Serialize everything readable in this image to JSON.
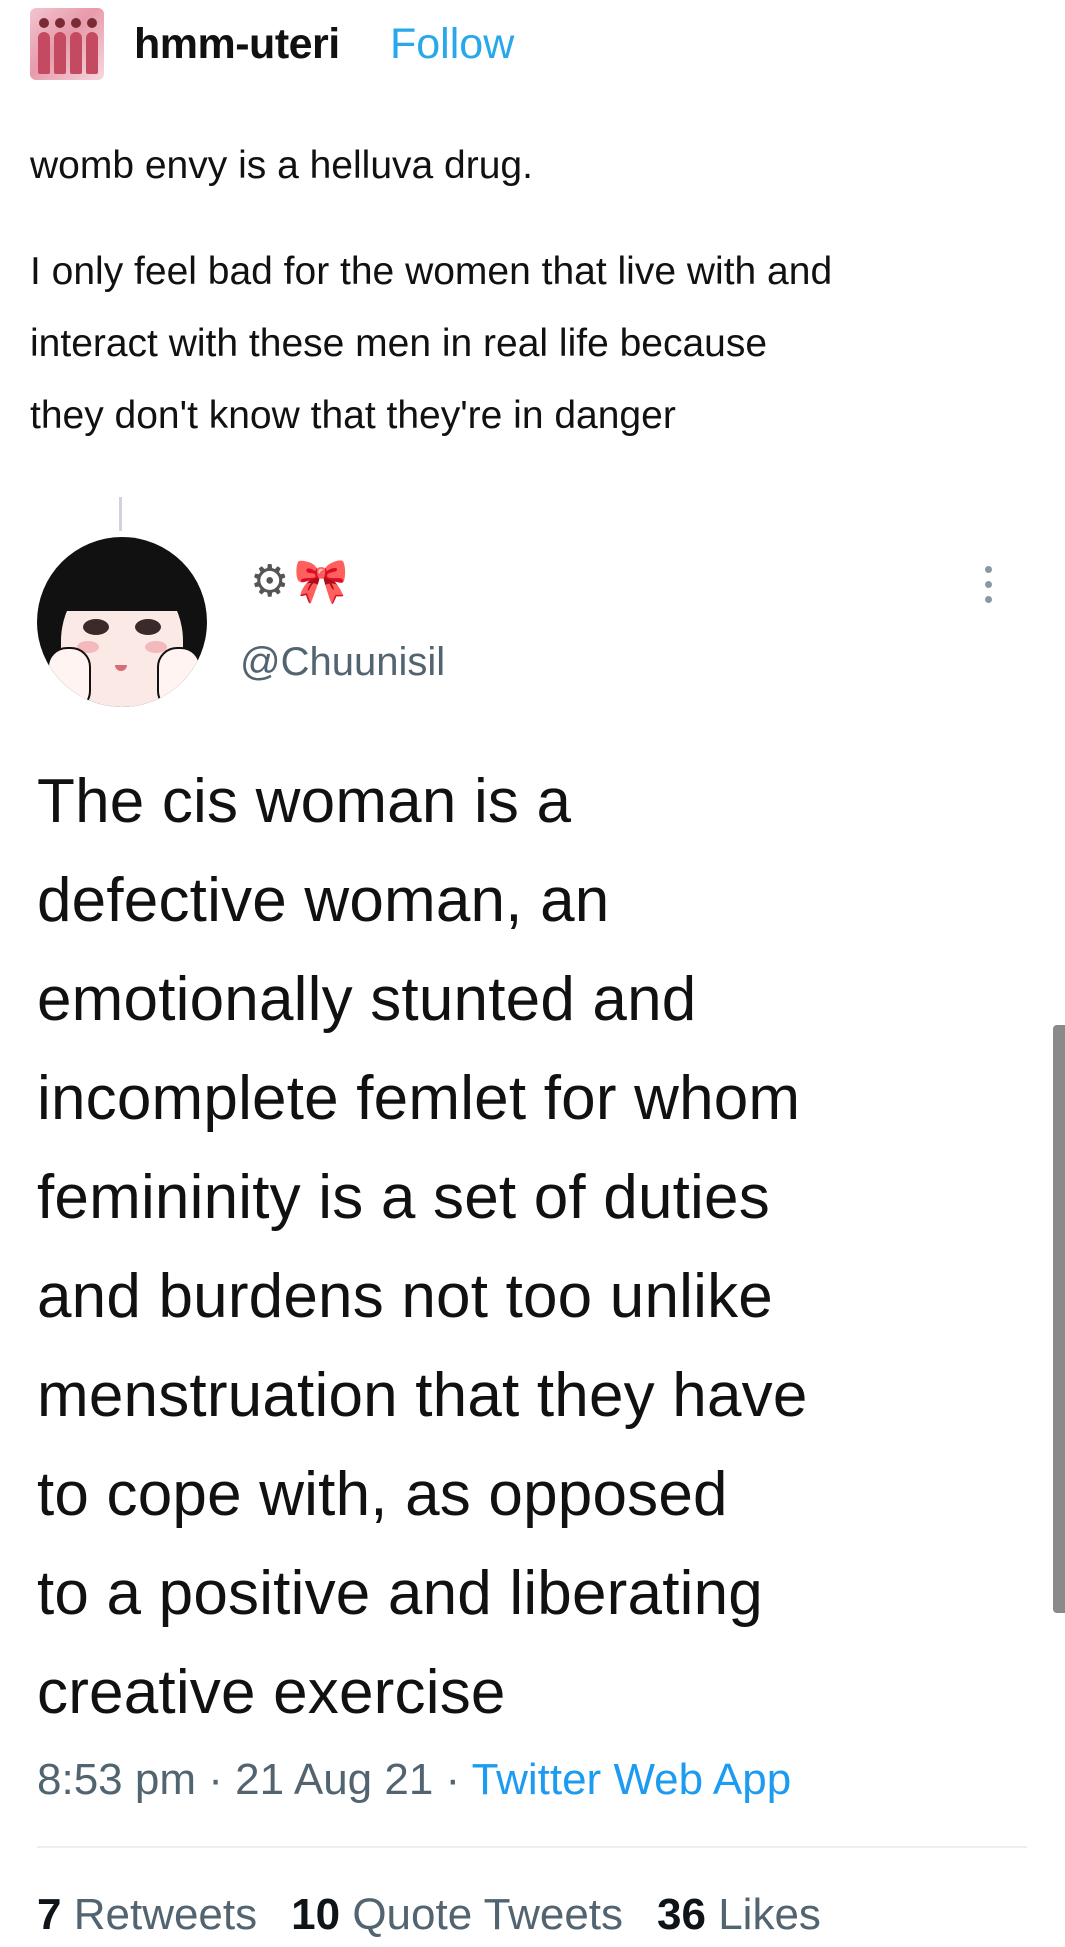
{
  "post": {
    "blog_name": "hmm-uteri",
    "follow_label": "Follow",
    "avatar_icon": "blog-avatar",
    "caption": "womb envy is a helluva drug.",
    "paragraph_lines": [
      "I only feel bad for the women that live with and",
      "interact with these men in real life because",
      "they don't know that they're in danger"
    ]
  },
  "tweet": {
    "display_name_icons": [
      "gear-icon",
      "ribbon-icon"
    ],
    "handle": "@Chuunisil",
    "more_icon": "more-options-icon",
    "body_lines": [
      "The cis woman is a",
      "defective woman, an",
      "emotionally stunted and",
      "incomplete femlet for whom",
      "femininity is a set of duties",
      "and burdens not too unlike",
      "menstruation that they have",
      "to cope with, as opposed",
      "to a positive and liberating",
      "creative exercise"
    ],
    "time": "8:53 pm",
    "date": "21 Aug 21",
    "separator": "·",
    "source": "Twitter Web App",
    "retweets_count": "7",
    "retweets_label": "Retweets",
    "quotes_count": "10",
    "quotes_label": "Quote Tweets",
    "likes_count": "36",
    "likes_label": "Likes"
  },
  "colors": {
    "link_blue": "#28a8ea",
    "twitter_blue": "#1d9bf0",
    "muted_gray": "#536471"
  }
}
